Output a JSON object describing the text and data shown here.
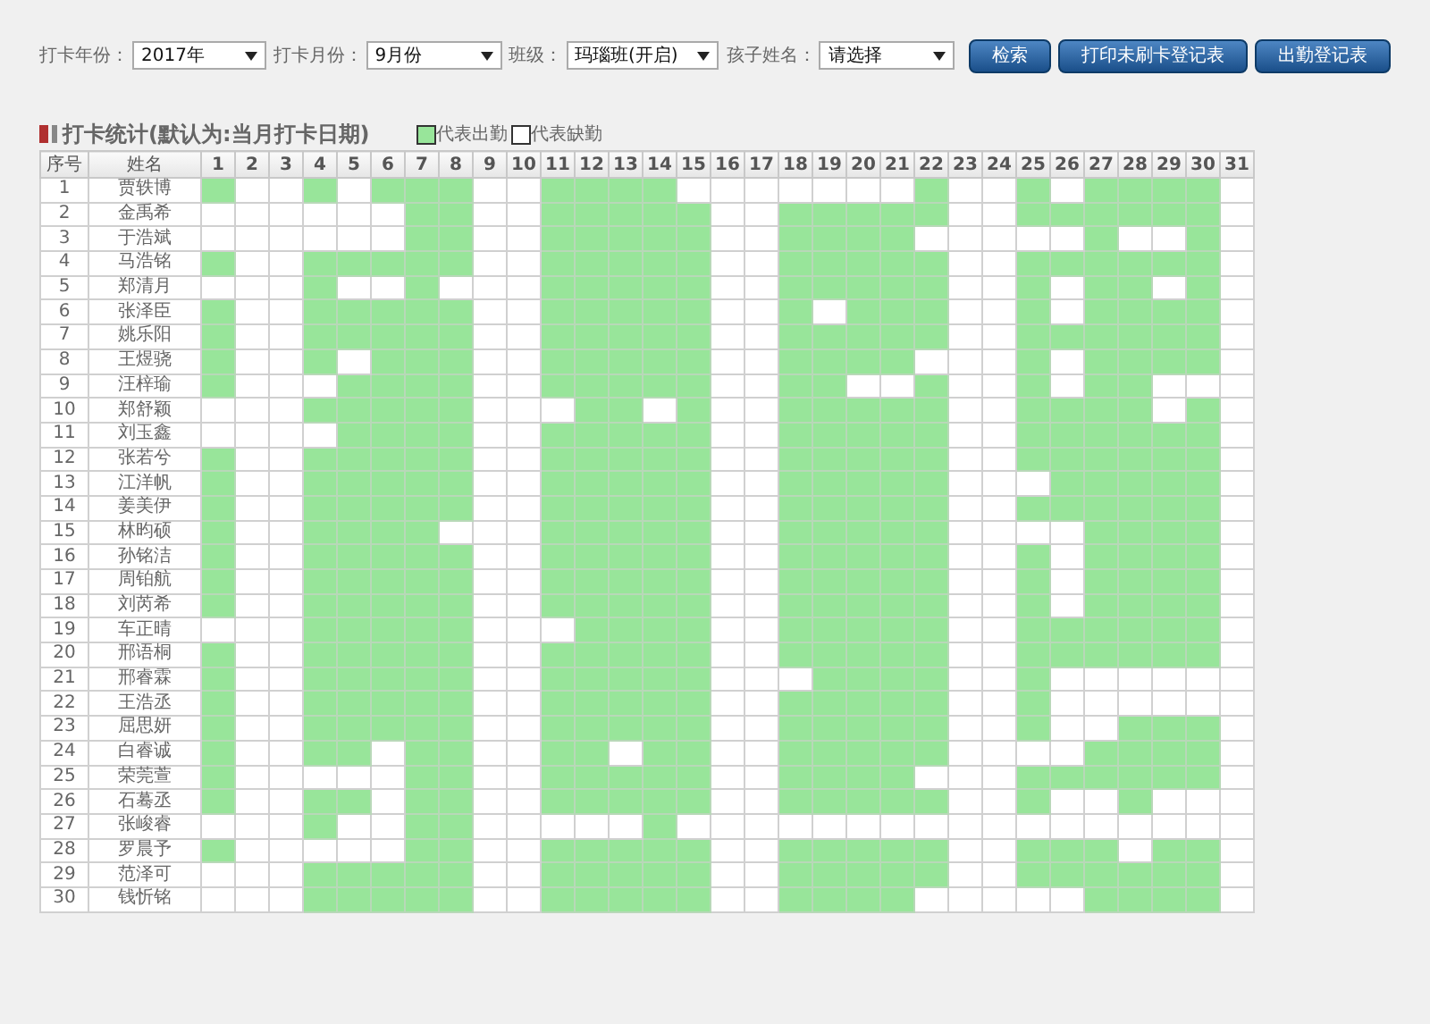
{
  "filters": [
    {
      "label": "打卡年份：",
      "value": "2017年"
    },
    {
      "label": "打卡月份：",
      "value": "9月份"
    },
    {
      "label": "班级：",
      "value": "玛瑙班(开启)"
    },
    {
      "label": "孩子姓名：",
      "value": "请选择"
    }
  ],
  "buttons": [
    "检索",
    "打印未刷卡登记表",
    "出勤登记表"
  ],
  "section_title": "打卡统计(默认为:当月打卡日期)",
  "legend": [
    {
      "label": "代表出勤",
      "attended": true
    },
    {
      "label": "代表缺勤",
      "attended": false
    }
  ],
  "table": {
    "columns": [
      "序号",
      "姓名",
      "1",
      "2",
      "3",
      "4",
      "5",
      "6",
      "7",
      "8",
      "9",
      "10",
      "11",
      "12",
      "13",
      "14",
      "15",
      "16",
      "17",
      "18",
      "19",
      "20",
      "21",
      "22",
      "23",
      "24",
      "25",
      "26",
      "27",
      "28",
      "29",
      "30",
      "31"
    ],
    "rows": [
      {
        "no": "1",
        "name": "贾轶博",
        "days": [
          true,
          false,
          false,
          true,
          false,
          true,
          true,
          true,
          false,
          false,
          true,
          true,
          true,
          true,
          false,
          false,
          false,
          false,
          false,
          false,
          false,
          true,
          false,
          false,
          true,
          false,
          true,
          true,
          true,
          true,
          false
        ]
      },
      {
        "no": "2",
        "name": "金禹希",
        "days": [
          false,
          false,
          false,
          false,
          false,
          false,
          true,
          true,
          false,
          false,
          true,
          true,
          true,
          true,
          true,
          false,
          false,
          true,
          true,
          true,
          true,
          true,
          false,
          false,
          true,
          true,
          true,
          true,
          true,
          true,
          false
        ]
      },
      {
        "no": "3",
        "name": "于浩斌",
        "days": [
          false,
          false,
          false,
          false,
          false,
          false,
          true,
          true,
          false,
          false,
          true,
          true,
          true,
          true,
          true,
          false,
          false,
          true,
          true,
          true,
          true,
          false,
          false,
          false,
          false,
          false,
          true,
          false,
          false,
          true,
          false
        ]
      },
      {
        "no": "4",
        "name": "马浩铭",
        "days": [
          true,
          false,
          false,
          true,
          true,
          true,
          true,
          true,
          false,
          false,
          true,
          true,
          true,
          true,
          true,
          false,
          false,
          true,
          true,
          true,
          true,
          true,
          false,
          false,
          true,
          true,
          true,
          true,
          true,
          true,
          false
        ]
      },
      {
        "no": "5",
        "name": "郑清月",
        "days": [
          false,
          false,
          false,
          true,
          false,
          false,
          true,
          false,
          false,
          false,
          true,
          true,
          true,
          true,
          true,
          false,
          false,
          true,
          true,
          true,
          true,
          true,
          false,
          false,
          true,
          false,
          true,
          true,
          false,
          true,
          false
        ]
      },
      {
        "no": "6",
        "name": "张泽臣",
        "days": [
          true,
          false,
          false,
          true,
          true,
          true,
          true,
          true,
          false,
          false,
          true,
          true,
          true,
          true,
          true,
          false,
          false,
          true,
          false,
          true,
          true,
          true,
          false,
          false,
          true,
          false,
          true,
          true,
          true,
          true,
          false
        ]
      },
      {
        "no": "7",
        "name": "姚乐阳",
        "days": [
          true,
          false,
          false,
          true,
          true,
          true,
          true,
          true,
          false,
          false,
          true,
          true,
          true,
          true,
          true,
          false,
          false,
          true,
          true,
          true,
          true,
          true,
          false,
          false,
          true,
          true,
          true,
          true,
          true,
          true,
          false
        ]
      },
      {
        "no": "8",
        "name": "王煜骁",
        "days": [
          true,
          false,
          false,
          true,
          false,
          true,
          true,
          true,
          false,
          false,
          true,
          true,
          true,
          true,
          true,
          false,
          false,
          true,
          true,
          true,
          true,
          false,
          false,
          false,
          true,
          false,
          true,
          true,
          true,
          true,
          false
        ]
      },
      {
        "no": "9",
        "name": "汪梓瑜",
        "days": [
          true,
          false,
          false,
          false,
          true,
          true,
          true,
          true,
          false,
          false,
          true,
          true,
          true,
          true,
          true,
          false,
          false,
          true,
          true,
          false,
          false,
          true,
          false,
          false,
          true,
          false,
          true,
          true,
          false,
          false,
          false
        ]
      },
      {
        "no": "10",
        "name": "郑舒颖",
        "days": [
          false,
          false,
          false,
          true,
          true,
          true,
          true,
          true,
          false,
          false,
          false,
          true,
          true,
          false,
          true,
          false,
          false,
          true,
          true,
          true,
          true,
          true,
          false,
          false,
          true,
          true,
          true,
          true,
          false,
          true,
          false
        ]
      },
      {
        "no": "11",
        "name": "刘玉鑫",
        "days": [
          false,
          false,
          false,
          false,
          true,
          true,
          true,
          true,
          false,
          false,
          true,
          true,
          true,
          true,
          true,
          false,
          false,
          true,
          true,
          true,
          true,
          true,
          false,
          false,
          true,
          true,
          true,
          true,
          true,
          true,
          false
        ]
      },
      {
        "no": "12",
        "name": "张若兮",
        "days": [
          true,
          false,
          false,
          true,
          true,
          true,
          true,
          true,
          false,
          false,
          true,
          true,
          true,
          true,
          true,
          false,
          false,
          true,
          true,
          true,
          true,
          true,
          false,
          false,
          true,
          true,
          true,
          true,
          true,
          true,
          false
        ]
      },
      {
        "no": "13",
        "name": "江洋帆",
        "days": [
          true,
          false,
          false,
          true,
          true,
          true,
          true,
          true,
          false,
          false,
          true,
          true,
          true,
          true,
          true,
          false,
          false,
          true,
          true,
          true,
          true,
          true,
          false,
          false,
          false,
          true,
          true,
          true,
          true,
          true,
          false
        ]
      },
      {
        "no": "14",
        "name": "姜美伊",
        "days": [
          true,
          false,
          false,
          true,
          true,
          true,
          true,
          true,
          false,
          false,
          true,
          true,
          true,
          true,
          true,
          false,
          false,
          true,
          true,
          true,
          true,
          true,
          false,
          false,
          true,
          true,
          true,
          true,
          true,
          true,
          false
        ]
      },
      {
        "no": "15",
        "name": "林昀硕",
        "days": [
          true,
          false,
          false,
          true,
          true,
          true,
          true,
          false,
          false,
          false,
          true,
          true,
          true,
          true,
          true,
          false,
          false,
          true,
          true,
          true,
          true,
          true,
          false,
          false,
          false,
          false,
          true,
          true,
          true,
          true,
          false
        ]
      },
      {
        "no": "16",
        "name": "孙铭洁",
        "days": [
          true,
          false,
          false,
          true,
          true,
          true,
          true,
          true,
          false,
          false,
          true,
          true,
          true,
          true,
          true,
          false,
          false,
          true,
          true,
          true,
          true,
          true,
          false,
          false,
          true,
          false,
          true,
          true,
          true,
          true,
          false
        ]
      },
      {
        "no": "17",
        "name": "周铂航",
        "days": [
          true,
          false,
          false,
          true,
          true,
          true,
          true,
          true,
          false,
          false,
          true,
          true,
          true,
          true,
          true,
          false,
          false,
          true,
          true,
          true,
          true,
          true,
          false,
          false,
          true,
          false,
          true,
          true,
          true,
          true,
          false
        ]
      },
      {
        "no": "18",
        "name": "刘芮希",
        "days": [
          true,
          false,
          false,
          true,
          true,
          true,
          true,
          true,
          false,
          false,
          true,
          true,
          true,
          true,
          true,
          false,
          false,
          true,
          true,
          true,
          true,
          true,
          false,
          false,
          true,
          false,
          true,
          true,
          true,
          true,
          false
        ]
      },
      {
        "no": "19",
        "name": "车正晴",
        "days": [
          false,
          false,
          false,
          true,
          true,
          true,
          true,
          true,
          false,
          false,
          false,
          true,
          true,
          true,
          true,
          false,
          false,
          true,
          true,
          true,
          true,
          true,
          false,
          false,
          true,
          true,
          true,
          true,
          true,
          true,
          false
        ]
      },
      {
        "no": "20",
        "name": "邢语桐",
        "days": [
          true,
          false,
          false,
          true,
          true,
          true,
          true,
          true,
          false,
          false,
          true,
          true,
          true,
          true,
          true,
          false,
          false,
          true,
          true,
          true,
          true,
          true,
          false,
          false,
          true,
          true,
          true,
          true,
          true,
          true,
          false
        ]
      },
      {
        "no": "21",
        "name": "邢睿霖",
        "days": [
          true,
          false,
          false,
          true,
          true,
          true,
          true,
          true,
          false,
          false,
          true,
          true,
          true,
          true,
          true,
          false,
          false,
          false,
          true,
          true,
          true,
          true,
          false,
          false,
          true,
          false,
          false,
          false,
          false,
          false,
          false
        ]
      },
      {
        "no": "22",
        "name": "王浩丞",
        "days": [
          true,
          false,
          false,
          true,
          true,
          true,
          true,
          true,
          false,
          false,
          true,
          true,
          true,
          true,
          true,
          false,
          false,
          true,
          true,
          true,
          true,
          true,
          false,
          false,
          true,
          false,
          false,
          false,
          false,
          false,
          false
        ]
      },
      {
        "no": "23",
        "name": "屈思妍",
        "days": [
          true,
          false,
          false,
          true,
          true,
          true,
          true,
          true,
          false,
          false,
          true,
          true,
          true,
          true,
          true,
          false,
          false,
          true,
          true,
          true,
          true,
          true,
          false,
          false,
          true,
          false,
          false,
          true,
          true,
          true,
          false
        ]
      },
      {
        "no": "24",
        "name": "白睿诚",
        "days": [
          true,
          false,
          false,
          true,
          true,
          false,
          true,
          true,
          false,
          false,
          true,
          true,
          false,
          true,
          true,
          false,
          false,
          true,
          true,
          true,
          true,
          true,
          false,
          false,
          false,
          false,
          true,
          true,
          true,
          true,
          false
        ]
      },
      {
        "no": "25",
        "name": "荣莞萱",
        "days": [
          true,
          false,
          false,
          false,
          false,
          false,
          true,
          true,
          false,
          false,
          true,
          true,
          true,
          true,
          true,
          false,
          false,
          true,
          true,
          true,
          true,
          false,
          false,
          false,
          true,
          true,
          true,
          true,
          true,
          true,
          false
        ]
      },
      {
        "no": "26",
        "name": "石蓦丞",
        "days": [
          true,
          false,
          false,
          true,
          true,
          false,
          true,
          true,
          false,
          false,
          true,
          true,
          true,
          true,
          true,
          false,
          false,
          true,
          true,
          true,
          true,
          true,
          false,
          false,
          true,
          false,
          false,
          true,
          false,
          false,
          false
        ]
      },
      {
        "no": "27",
        "name": "张峻睿",
        "days": [
          false,
          false,
          false,
          true,
          false,
          false,
          true,
          true,
          false,
          false,
          false,
          false,
          false,
          true,
          false,
          false,
          false,
          false,
          false,
          false,
          false,
          false,
          false,
          false,
          false,
          false,
          false,
          false,
          false,
          false,
          false
        ]
      },
      {
        "no": "28",
        "name": "罗晨予",
        "days": [
          true,
          false,
          false,
          false,
          false,
          false,
          true,
          true,
          false,
          false,
          true,
          true,
          true,
          true,
          true,
          false,
          false,
          true,
          true,
          true,
          true,
          true,
          false,
          false,
          true,
          true,
          true,
          false,
          true,
          true,
          false
        ]
      },
      {
        "no": "29",
        "name": "范泽可",
        "days": [
          false,
          false,
          false,
          true,
          true,
          true,
          true,
          true,
          false,
          false,
          true,
          true,
          true,
          true,
          true,
          false,
          false,
          true,
          true,
          true,
          true,
          true,
          false,
          false,
          true,
          true,
          true,
          true,
          true,
          true,
          false
        ]
      },
      {
        "no": "30",
        "name": "钱忻铭",
        "days": [
          false,
          false,
          false,
          true,
          true,
          true,
          true,
          true,
          false,
          false,
          true,
          true,
          true,
          true,
          true,
          false,
          false,
          true,
          true,
          true,
          true,
          false,
          false,
          false,
          false,
          false,
          true,
          true,
          true,
          true,
          false
        ]
      }
    ]
  }
}
